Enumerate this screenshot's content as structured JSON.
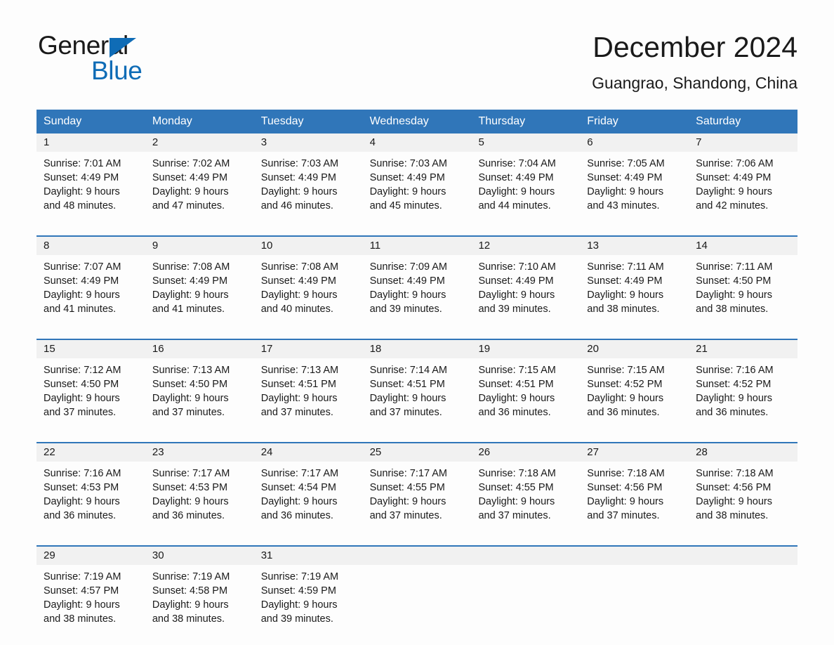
{
  "brand": {
    "name_part1": "General",
    "name_part2": "Blue",
    "triangle_color": "#0f6cb6",
    "text_color": "#1a1a1a"
  },
  "header": {
    "title": "December 2024",
    "location": "Guangrao, Shandong, China",
    "accent_color": "#3076b9",
    "daynum_band_color": "#f1f1f1"
  },
  "calendar": {
    "weekdays": [
      "Sunday",
      "Monday",
      "Tuesday",
      "Wednesday",
      "Thursday",
      "Friday",
      "Saturday"
    ],
    "weeks": [
      {
        "days": [
          {
            "num": "1",
            "sunrise": "Sunrise: 7:01 AM",
            "sunset": "Sunset: 4:49 PM",
            "daylight": "Daylight: 9 hours and 48 minutes."
          },
          {
            "num": "2",
            "sunrise": "Sunrise: 7:02 AM",
            "sunset": "Sunset: 4:49 PM",
            "daylight": "Daylight: 9 hours and 47 minutes."
          },
          {
            "num": "3",
            "sunrise": "Sunrise: 7:03 AM",
            "sunset": "Sunset: 4:49 PM",
            "daylight": "Daylight: 9 hours and 46 minutes."
          },
          {
            "num": "4",
            "sunrise": "Sunrise: 7:03 AM",
            "sunset": "Sunset: 4:49 PM",
            "daylight": "Daylight: 9 hours and 45 minutes."
          },
          {
            "num": "5",
            "sunrise": "Sunrise: 7:04 AM",
            "sunset": "Sunset: 4:49 PM",
            "daylight": "Daylight: 9 hours and 44 minutes."
          },
          {
            "num": "6",
            "sunrise": "Sunrise: 7:05 AM",
            "sunset": "Sunset: 4:49 PM",
            "daylight": "Daylight: 9 hours and 43 minutes."
          },
          {
            "num": "7",
            "sunrise": "Sunrise: 7:06 AM",
            "sunset": "Sunset: 4:49 PM",
            "daylight": "Daylight: 9 hours and 42 minutes."
          }
        ]
      },
      {
        "days": [
          {
            "num": "8",
            "sunrise": "Sunrise: 7:07 AM",
            "sunset": "Sunset: 4:49 PM",
            "daylight": "Daylight: 9 hours and 41 minutes."
          },
          {
            "num": "9",
            "sunrise": "Sunrise: 7:08 AM",
            "sunset": "Sunset: 4:49 PM",
            "daylight": "Daylight: 9 hours and 41 minutes."
          },
          {
            "num": "10",
            "sunrise": "Sunrise: 7:08 AM",
            "sunset": "Sunset: 4:49 PM",
            "daylight": "Daylight: 9 hours and 40 minutes."
          },
          {
            "num": "11",
            "sunrise": "Sunrise: 7:09 AM",
            "sunset": "Sunset: 4:49 PM",
            "daylight": "Daylight: 9 hours and 39 minutes."
          },
          {
            "num": "12",
            "sunrise": "Sunrise: 7:10 AM",
            "sunset": "Sunset: 4:49 PM",
            "daylight": "Daylight: 9 hours and 39 minutes."
          },
          {
            "num": "13",
            "sunrise": "Sunrise: 7:11 AM",
            "sunset": "Sunset: 4:49 PM",
            "daylight": "Daylight: 9 hours and 38 minutes."
          },
          {
            "num": "14",
            "sunrise": "Sunrise: 7:11 AM",
            "sunset": "Sunset: 4:50 PM",
            "daylight": "Daylight: 9 hours and 38 minutes."
          }
        ]
      },
      {
        "days": [
          {
            "num": "15",
            "sunrise": "Sunrise: 7:12 AM",
            "sunset": "Sunset: 4:50 PM",
            "daylight": "Daylight: 9 hours and 37 minutes."
          },
          {
            "num": "16",
            "sunrise": "Sunrise: 7:13 AM",
            "sunset": "Sunset: 4:50 PM",
            "daylight": "Daylight: 9 hours and 37 minutes."
          },
          {
            "num": "17",
            "sunrise": "Sunrise: 7:13 AM",
            "sunset": "Sunset: 4:51 PM",
            "daylight": "Daylight: 9 hours and 37 minutes."
          },
          {
            "num": "18",
            "sunrise": "Sunrise: 7:14 AM",
            "sunset": "Sunset: 4:51 PM",
            "daylight": "Daylight: 9 hours and 37 minutes."
          },
          {
            "num": "19",
            "sunrise": "Sunrise: 7:15 AM",
            "sunset": "Sunset: 4:51 PM",
            "daylight": "Daylight: 9 hours and 36 minutes."
          },
          {
            "num": "20",
            "sunrise": "Sunrise: 7:15 AM",
            "sunset": "Sunset: 4:52 PM",
            "daylight": "Daylight: 9 hours and 36 minutes."
          },
          {
            "num": "21",
            "sunrise": "Sunrise: 7:16 AM",
            "sunset": "Sunset: 4:52 PM",
            "daylight": "Daylight: 9 hours and 36 minutes."
          }
        ]
      },
      {
        "days": [
          {
            "num": "22",
            "sunrise": "Sunrise: 7:16 AM",
            "sunset": "Sunset: 4:53 PM",
            "daylight": "Daylight: 9 hours and 36 minutes."
          },
          {
            "num": "23",
            "sunrise": "Sunrise: 7:17 AM",
            "sunset": "Sunset: 4:53 PM",
            "daylight": "Daylight: 9 hours and 36 minutes."
          },
          {
            "num": "24",
            "sunrise": "Sunrise: 7:17 AM",
            "sunset": "Sunset: 4:54 PM",
            "daylight": "Daylight: 9 hours and 36 minutes."
          },
          {
            "num": "25",
            "sunrise": "Sunrise: 7:17 AM",
            "sunset": "Sunset: 4:55 PM",
            "daylight": "Daylight: 9 hours and 37 minutes."
          },
          {
            "num": "26",
            "sunrise": "Sunrise: 7:18 AM",
            "sunset": "Sunset: 4:55 PM",
            "daylight": "Daylight: 9 hours and 37 minutes."
          },
          {
            "num": "27",
            "sunrise": "Sunrise: 7:18 AM",
            "sunset": "Sunset: 4:56 PM",
            "daylight": "Daylight: 9 hours and 37 minutes."
          },
          {
            "num": "28",
            "sunrise": "Sunrise: 7:18 AM",
            "sunset": "Sunset: 4:56 PM",
            "daylight": "Daylight: 9 hours and 38 minutes."
          }
        ]
      },
      {
        "days": [
          {
            "num": "29",
            "sunrise": "Sunrise: 7:19 AM",
            "sunset": "Sunset: 4:57 PM",
            "daylight": "Daylight: 9 hours and 38 minutes."
          },
          {
            "num": "30",
            "sunrise": "Sunrise: 7:19 AM",
            "sunset": "Sunset: 4:58 PM",
            "daylight": "Daylight: 9 hours and 38 minutes."
          },
          {
            "num": "31",
            "sunrise": "Sunrise: 7:19 AM",
            "sunset": "Sunset: 4:59 PM",
            "daylight": "Daylight: 9 hours and 39 minutes."
          },
          {
            "num": "",
            "sunrise": "",
            "sunset": "",
            "daylight": ""
          },
          {
            "num": "",
            "sunrise": "",
            "sunset": "",
            "daylight": ""
          },
          {
            "num": "",
            "sunrise": "",
            "sunset": "",
            "daylight": ""
          },
          {
            "num": "",
            "sunrise": "",
            "sunset": "",
            "daylight": ""
          }
        ]
      }
    ]
  }
}
